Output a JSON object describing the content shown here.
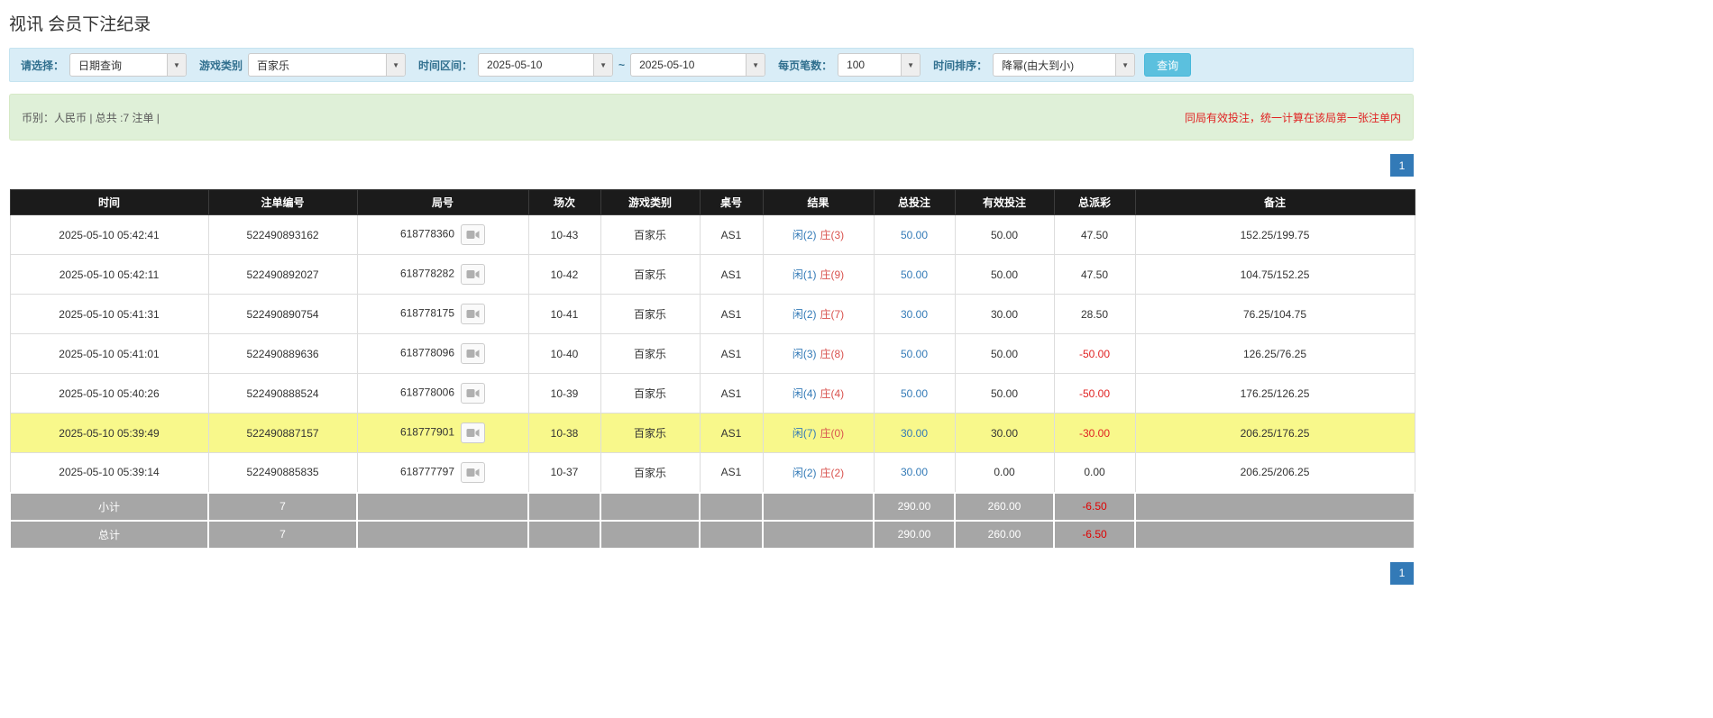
{
  "page": {
    "title": "视讯 会员下注纪录"
  },
  "filter_bar": {
    "select_label": "请选择：",
    "select_value": "日期查询",
    "game_type_label": "游戏类别",
    "game_type_value": "百家乐",
    "time_range_label": "时间区间：",
    "date_from": "2025-05-10",
    "range_separator": "~",
    "date_to": "2025-05-10",
    "page_size_label": "每页笔数：",
    "page_size_value": "100",
    "time_sort_label": "时间排序：",
    "time_sort_value": "降幂(由大到小)",
    "search_button_label": "查询"
  },
  "summary_bar": {
    "left_text": "币别：人民币 | 总共 :7 注单 |",
    "right_notice": "同局有效投注，统一计算在该局第一张注单内"
  },
  "pagination": {
    "current_page": "1"
  },
  "colors": {
    "accent_blue": "#337ab7",
    "search_button_blue": "#5bc0de",
    "player_blue": "#337ab7",
    "banker_red": "#d9534f",
    "negative_red": "#e02222",
    "highlight_yellow": "#f8f88b",
    "header_black": "#1b1b1b",
    "footer_gray": "#a6a6a6",
    "filter_bg": "#d9edf7",
    "summary_bg": "#dff0d8"
  },
  "table": {
    "headers": [
      "时间",
      "注单编号",
      "局号",
      "场次",
      "游戏类别",
      "桌号",
      "结果",
      "总投注",
      "有效投注",
      "总派彩",
      "备注"
    ],
    "rows": [
      {
        "time": "2025-05-10 05:42:41",
        "bet_no": "522490893162",
        "round_no": "618778360",
        "session": "10-43",
        "game": "百家乐",
        "table_no": "AS1",
        "player": "闲(2)",
        "banker": "庄(3)",
        "total_bet": "50.00",
        "valid_bet": "50.00",
        "payout": "47.50",
        "note": "152.25/199.75",
        "highlight": false
      },
      {
        "time": "2025-05-10 05:42:11",
        "bet_no": "522490892027",
        "round_no": "618778282",
        "session": "10-42",
        "game": "百家乐",
        "table_no": "AS1",
        "player": "闲(1)",
        "banker": "庄(9)",
        "total_bet": "50.00",
        "valid_bet": "50.00",
        "payout": "47.50",
        "note": "104.75/152.25",
        "highlight": false
      },
      {
        "time": "2025-05-10 05:41:31",
        "bet_no": "522490890754",
        "round_no": "618778175",
        "session": "10-41",
        "game": "百家乐",
        "table_no": "AS1",
        "player": "闲(2)",
        "banker": "庄(7)",
        "total_bet": "30.00",
        "valid_bet": "30.00",
        "payout": "28.50",
        "note": "76.25/104.75",
        "highlight": false
      },
      {
        "time": "2025-05-10 05:41:01",
        "bet_no": "522490889636",
        "round_no": "618778096",
        "session": "10-40",
        "game": "百家乐",
        "table_no": "AS1",
        "player": "闲(3)",
        "banker": "庄(8)",
        "total_bet": "50.00",
        "valid_bet": "50.00",
        "payout": "-50.00",
        "note": "126.25/76.25",
        "highlight": false
      },
      {
        "time": "2025-05-10 05:40:26",
        "bet_no": "522490888524",
        "round_no": "618778006",
        "session": "10-39",
        "game": "百家乐",
        "table_no": "AS1",
        "player": "闲(4)",
        "banker": "庄(4)",
        "total_bet": "50.00",
        "valid_bet": "50.00",
        "payout": "-50.00",
        "note": "176.25/126.25",
        "highlight": false
      },
      {
        "time": "2025-05-10 05:39:49",
        "bet_no": "522490887157",
        "round_no": "618777901",
        "session": "10-38",
        "game": "百家乐",
        "table_no": "AS1",
        "player": "闲(7)",
        "banker": "庄(0)",
        "total_bet": "30.00",
        "valid_bet": "30.00",
        "payout": "-30.00",
        "note": "206.25/176.25",
        "highlight": true
      },
      {
        "time": "2025-05-10 05:39:14",
        "bet_no": "522490885835",
        "round_no": "618777797",
        "session": "10-37",
        "game": "百家乐",
        "table_no": "AS1",
        "player": "闲(2)",
        "banker": "庄(2)",
        "total_bet": "30.00",
        "valid_bet": "0.00",
        "payout": "0.00",
        "note": "206.25/206.25",
        "highlight": false
      }
    ],
    "subtotal_row": {
      "label": "小计",
      "count": "7",
      "total_bet": "290.00",
      "valid_bet": "260.00",
      "payout": "-6.50"
    },
    "total_row": {
      "label": "总计",
      "count": "7",
      "total_bet": "290.00",
      "valid_bet": "260.00",
      "payout": "-6.50"
    }
  }
}
